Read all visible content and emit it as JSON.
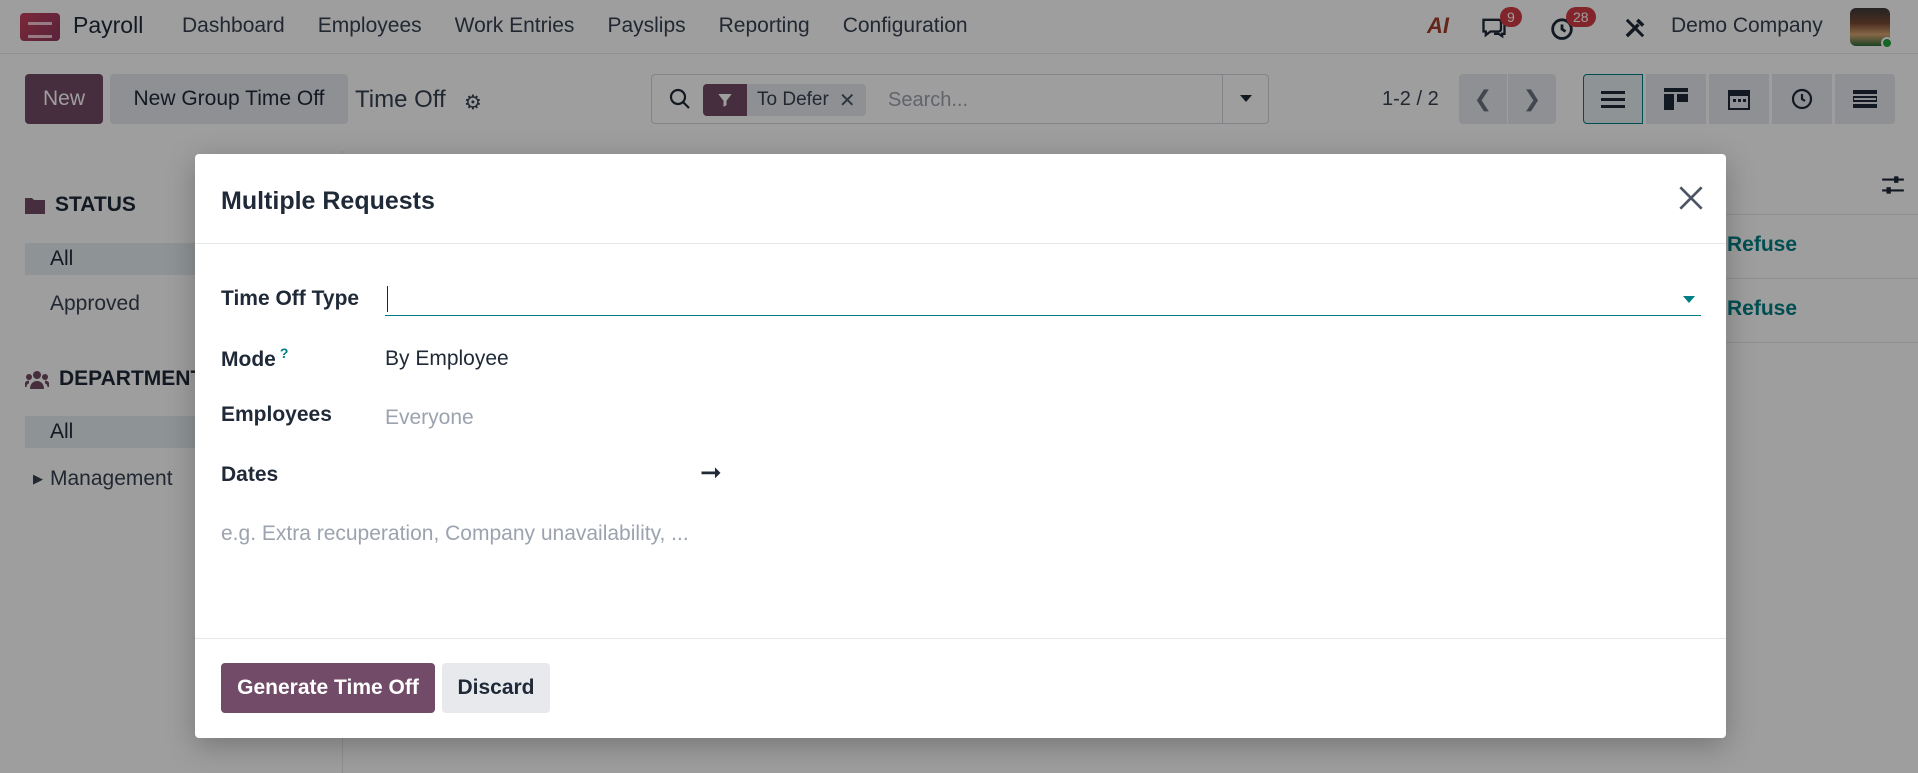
{
  "navbar": {
    "app_name": "Payroll",
    "menu": [
      "Dashboard",
      "Employees",
      "Work Entries",
      "Payslips",
      "Reporting",
      "Configuration"
    ],
    "ai_label": "AI",
    "messages_count": "9",
    "activities_count": "28",
    "company": "Demo Company"
  },
  "control": {
    "new_label": "New",
    "group_label": "New Group Time Off",
    "breadcrumb": "Time Off",
    "facet_label": "To Defer",
    "search_placeholder": "Search...",
    "pager": "1-2 / 2"
  },
  "sidebar": {
    "status_heading": "STATUS",
    "status_items": [
      "All",
      "Approved"
    ],
    "department_heading": "DEPARTMENT",
    "department_items": [
      "All",
      "Management"
    ]
  },
  "list": {
    "rows": [
      {
        "action": "Refuse"
      },
      {
        "action": "Refuse"
      }
    ]
  },
  "modal": {
    "title": "Multiple Requests",
    "fields": {
      "time_off_type_label": "Time Off Type",
      "time_off_type_value": "",
      "mode_label": "Mode",
      "mode_help": "?",
      "mode_value": "By Employee",
      "employees_label": "Employees",
      "employees_placeholder": "Everyone",
      "dates_label": "Dates",
      "dates_arrow": "➞",
      "notes_placeholder": "e.g. Extra recuperation, Company unavailability, ..."
    },
    "footer": {
      "generate_label": "Generate Time Off",
      "discard_label": "Discard"
    }
  },
  "colors": {
    "primary": "#714b67",
    "accent": "#017e84",
    "badge": "#d23d44"
  }
}
